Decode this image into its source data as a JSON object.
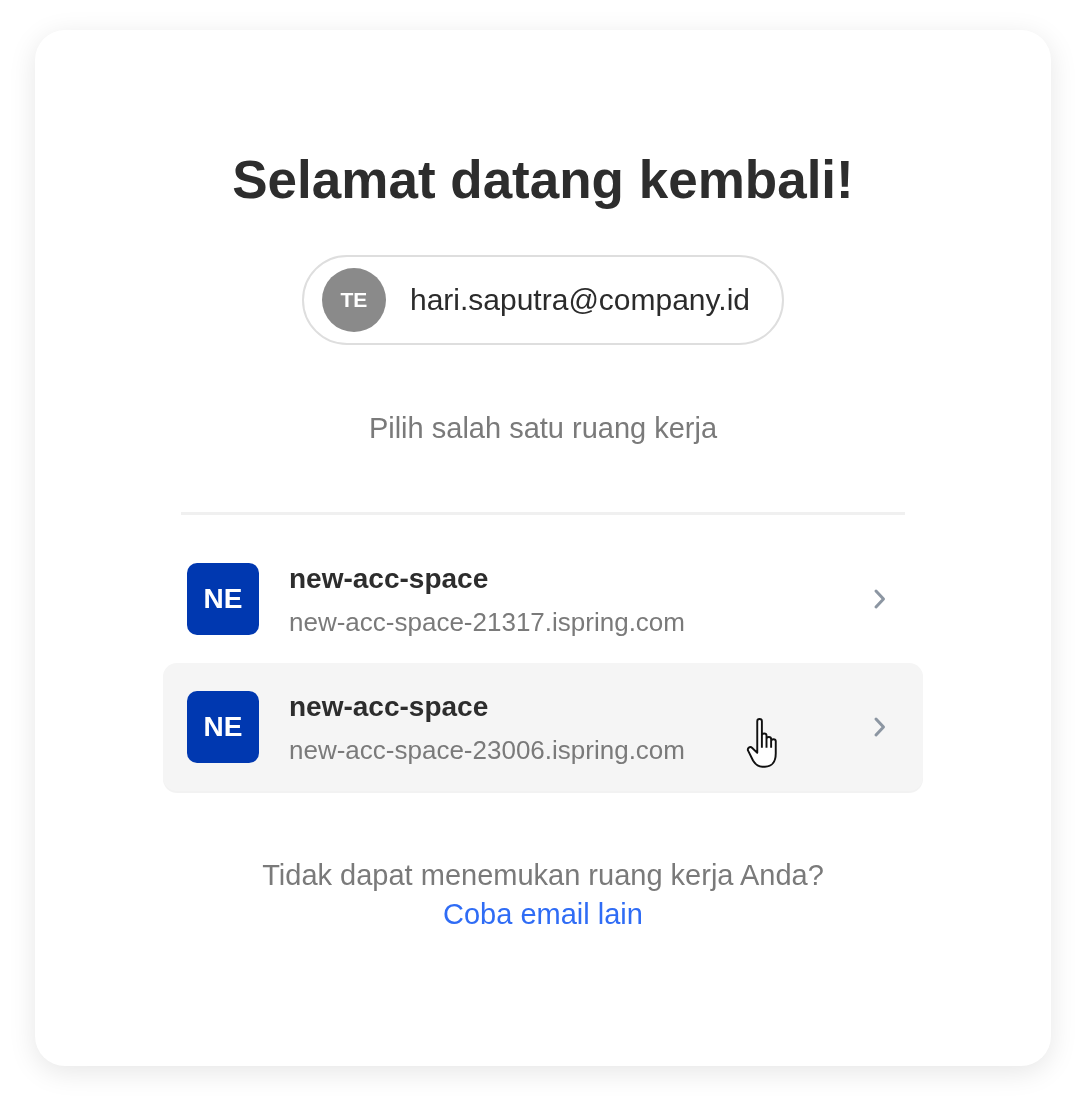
{
  "heading": "Selamat datang kembali!",
  "account": {
    "initials": "TE",
    "email": "hari.saputra@company.id"
  },
  "prompt": "Pilih salah satu ruang kerja",
  "workspaces": [
    {
      "initials": "NE",
      "name": "new-acc-space",
      "url": "new-acc-space-21317.ispring.com",
      "hovered": false
    },
    {
      "initials": "NE",
      "name": "new-acc-space",
      "url": "new-acc-space-23006.ispring.com",
      "hovered": true
    }
  ],
  "footer": {
    "question": "Tidak dapat menemukan ruang kerja Anda?",
    "link": "Coba email lain"
  }
}
